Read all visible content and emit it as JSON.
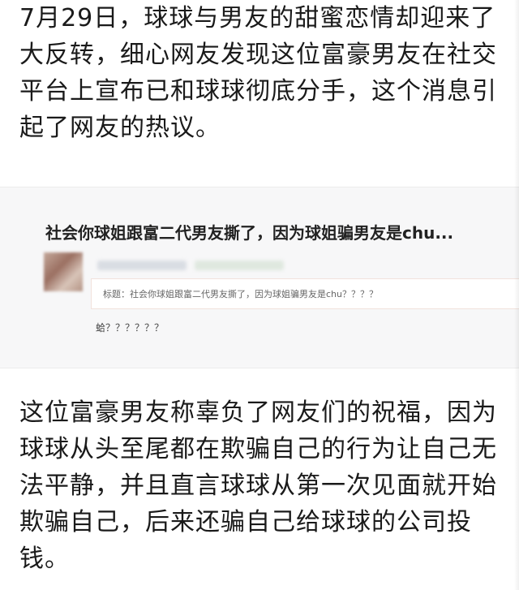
{
  "article": {
    "paragraph_1": "7月29日，球球与男友的甜蜜恋情却迎来了大反转，细心网友发现这位富豪男友在社交平台上宣布已和球球彻底分手，这个消息引起了网友的热议。",
    "embedded_screenshot": {
      "title": "社会你球姐跟富二代男友撕了，因为球姐骗男友是chu...",
      "quote": "标题：社会你球姐跟富二代男友撕了，因为球姐骗男友是chu？？？？",
      "reply": "蛤？？？？？？"
    },
    "paragraph_2": "这位富豪男友称辜负了网友们的祝福，因为球球从头至尾都在欺骗自己的行为让自己无法平静，并且直言球球从第一次见面就开始欺骗自己，后来还骗自己给球球的公司投钱。"
  }
}
